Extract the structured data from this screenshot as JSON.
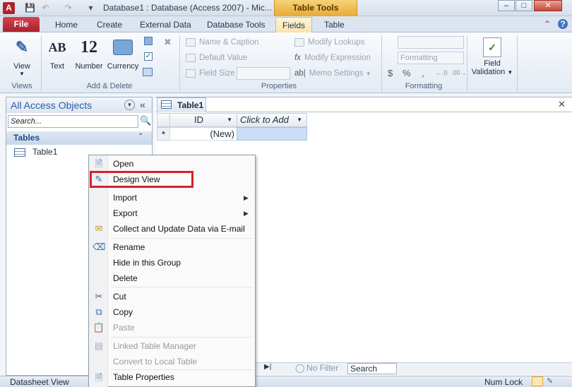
{
  "title": {
    "window_title": "Database1 : Database (Access 2007) - Mic...",
    "context_header": "Table Tools",
    "app_icon": "A"
  },
  "tabs": [
    "File",
    "Home",
    "Create",
    "External Data",
    "Database Tools",
    "Fields",
    "Table"
  ],
  "active_tab": "Fields",
  "ribbon": {
    "views": {
      "view_label": "View",
      "group": "Views"
    },
    "add_delete": {
      "text": "Text",
      "number": "Number",
      "currency": "Currency",
      "text_glyph": "AB",
      "number_glyph": "12",
      "group": "Add & Delete"
    },
    "properties": {
      "name_caption": "Name & Caption",
      "default_value": "Default Value",
      "field_size": "Field Size",
      "modify_lookups": "Modify Lookups",
      "modify_expression": "Modify Expression",
      "memo_settings": "Memo Settings",
      "group": "Properties"
    },
    "formatting": {
      "format_placeholder": "Formatting",
      "symbols": [
        "$",
        "%",
        ","
      ],
      "group": "Formatting"
    },
    "field_validation": {
      "line1": "Field",
      "line2": "Validation"
    }
  },
  "nav_pane": {
    "header": "All Access Objects",
    "search_placeholder": "Search...",
    "section": "Tables",
    "items": [
      "Table1"
    ]
  },
  "document": {
    "tab": "Table1",
    "columns": [
      "ID",
      "Click to Add"
    ],
    "new_row_marker": "*",
    "new_row_value": "(New)"
  },
  "context_menu": {
    "items": [
      {
        "label": "Open",
        "disabled": false
      },
      {
        "label": "Design View",
        "disabled": false
      },
      {
        "label": "Import",
        "disabled": false
      },
      {
        "label": "Export",
        "disabled": false
      },
      {
        "label": "Collect and Update Data via E-mail",
        "disabled": false
      },
      {
        "label": "Rename",
        "disabled": false
      },
      {
        "label": "Hide in this Group",
        "disabled": false
      },
      {
        "label": "Delete",
        "disabled": false
      },
      {
        "label": "Cut",
        "disabled": false
      },
      {
        "label": "Copy",
        "disabled": false
      },
      {
        "label": "Paste",
        "disabled": true
      },
      {
        "label": "Linked Table Manager",
        "disabled": true
      },
      {
        "label": "Convert to Local Table",
        "disabled": true
      },
      {
        "label": "Table Properties",
        "disabled": false
      }
    ]
  },
  "record_nav": {
    "no_filter": "No Filter",
    "search": "Search"
  },
  "status": {
    "left": "Datasheet View",
    "num_lock": "Num Lock"
  },
  "colors": {
    "file_tab": "#b8232f",
    "context_tab": "#f0c050",
    "highlight_box": "#d9202a",
    "new_field_cell": "#c9ddf7"
  }
}
